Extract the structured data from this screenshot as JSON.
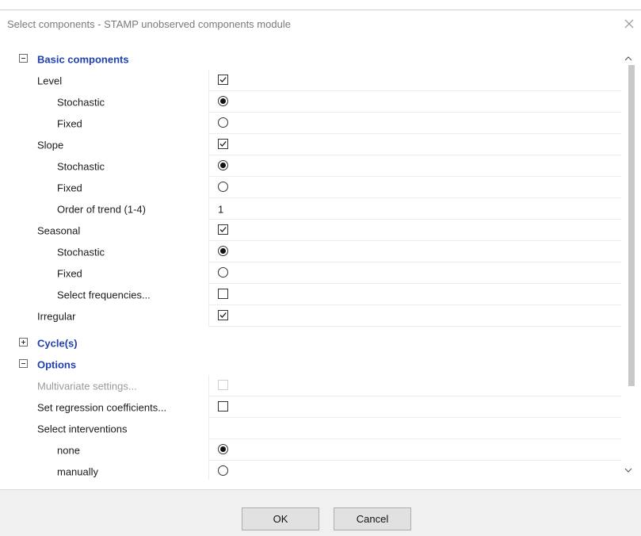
{
  "window": {
    "title": "Select components - STAMP unobserved components module",
    "close_glyph": "×"
  },
  "groups": {
    "basic": {
      "title": "Basic components",
      "expanded": true,
      "level": {
        "label": "Level",
        "checked": true
      },
      "level_stochastic": {
        "label": "Stochastic",
        "selected": true
      },
      "level_fixed": {
        "label": "Fixed",
        "selected": false
      },
      "slope": {
        "label": "Slope",
        "checked": true
      },
      "slope_stochastic": {
        "label": "Stochastic",
        "selected": true
      },
      "slope_fixed": {
        "label": "Fixed",
        "selected": false
      },
      "slope_order": {
        "label": "Order of trend (1-4)",
        "value": "1"
      },
      "seasonal": {
        "label": "Seasonal",
        "checked": true
      },
      "seasonal_stochastic": {
        "label": "Stochastic",
        "selected": true
      },
      "seasonal_fixed": {
        "label": "Fixed",
        "selected": false
      },
      "seasonal_frequencies": {
        "label": "Select frequencies...",
        "checked": false
      },
      "irregular": {
        "label": "Irregular",
        "checked": true
      }
    },
    "cycles": {
      "title": "Cycle(s)",
      "expanded": false
    },
    "options": {
      "title": "Options",
      "expanded": true,
      "multivariate": {
        "label": "Multivariate settings...",
        "checked": false,
        "disabled": true
      },
      "regression": {
        "label": "Set regression coefficients...",
        "checked": false
      },
      "interventions": {
        "label": "Select interventions"
      },
      "interventions_none": {
        "label": "none",
        "selected": true
      },
      "interventions_manually": {
        "label": "manually",
        "selected": false
      }
    }
  },
  "buttons": {
    "ok_label": "OK",
    "cancel_label": "Cancel"
  },
  "icons": {
    "close": "close-icon",
    "collapse": "minus-box-icon",
    "expand": "plus-box-icon",
    "scroll_up": "chevron-up-icon",
    "scroll_down": "chevron-down-icon"
  }
}
